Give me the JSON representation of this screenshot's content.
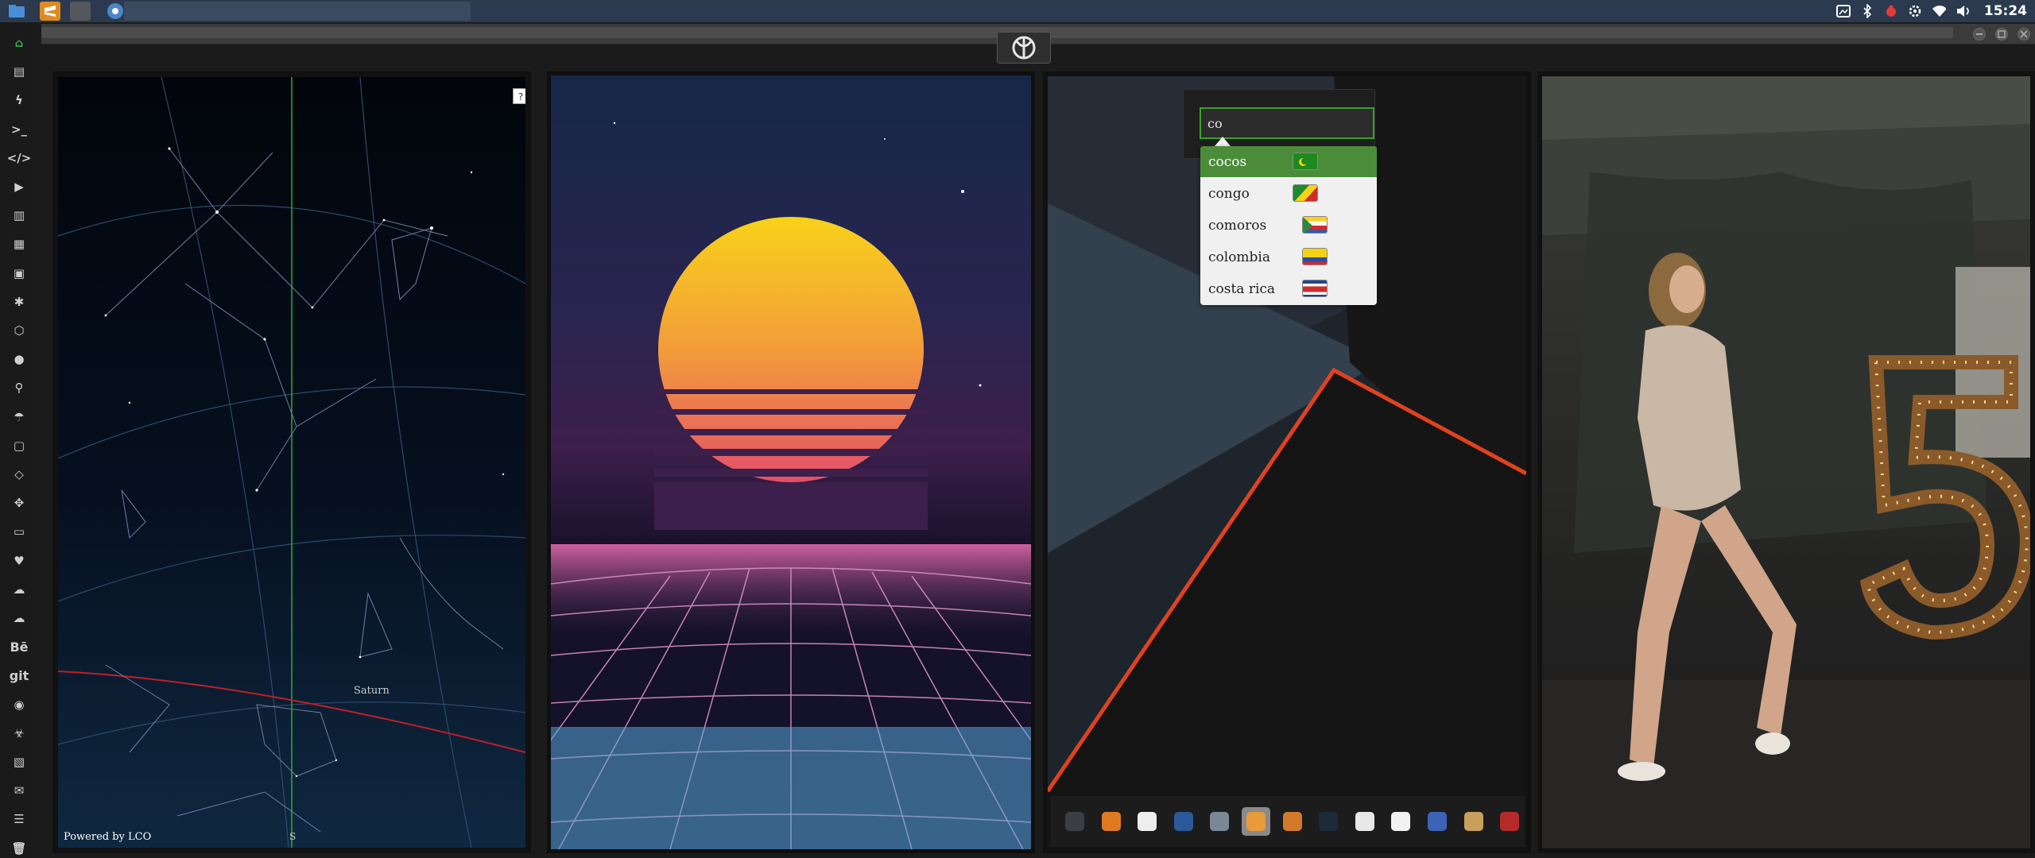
{
  "system": {
    "clock": "15:24"
  },
  "sky_panel": {
    "help_label": "?",
    "credit": "Powered by LCO",
    "planet_label": "Saturn",
    "direction_label": "S"
  },
  "search": {
    "value": "co",
    "suggestions": [
      {
        "label": "cocos",
        "flag": "flag-cocos-islands"
      },
      {
        "label": "congo",
        "flag": "flag-congo"
      },
      {
        "label": "comoros",
        "flag": "flag-comoros"
      },
      {
        "label": "colombia",
        "flag": "flag-colombia"
      },
      {
        "label": "costa rica",
        "flag": "flag-costa-rica"
      }
    ],
    "active_index": 0
  },
  "sidebar": {
    "items": [
      {
        "icon": "home-icon"
      },
      {
        "icon": "document-icon"
      },
      {
        "icon": "bolt-icon"
      },
      {
        "icon": "terminal-icon"
      },
      {
        "icon": "code-icon"
      },
      {
        "icon": "play-icon"
      },
      {
        "icon": "translate-icon"
      },
      {
        "icon": "image-icon"
      },
      {
        "icon": "news-icon"
      },
      {
        "icon": "settings-icon"
      },
      {
        "icon": "hexagon-icon"
      },
      {
        "icon": "globe-icon"
      },
      {
        "icon": "search-icon"
      },
      {
        "icon": "umbrella-icon"
      },
      {
        "icon": "contact-icon"
      },
      {
        "icon": "tag-icon"
      },
      {
        "icon": "fullscreen-icon"
      },
      {
        "icon": "youtube-icon"
      },
      {
        "icon": "heart-icon"
      },
      {
        "icon": "cloud-outline-icon"
      },
      {
        "icon": "cloud-icon"
      },
      {
        "label": "Bē",
        "icon": "behance-icon"
      },
      {
        "label": "git",
        "icon": "git-icon"
      },
      {
        "icon": "github-icon"
      },
      {
        "icon": "biohazard-icon"
      },
      {
        "icon": "map-icon"
      },
      {
        "icon": "mail-icon"
      },
      {
        "icon": "list-icon"
      },
      {
        "icon": "trash-icon"
      }
    ]
  },
  "dock": {
    "items": [
      {
        "icon": "calculator-icon"
      },
      {
        "icon": "sublime-icon"
      },
      {
        "icon": "calendar-icon"
      },
      {
        "icon": "globe-icon"
      },
      {
        "icon": "clock-icon"
      },
      {
        "icon": "search-icon"
      },
      {
        "icon": "photos-icon"
      },
      {
        "icon": "earth-icon"
      },
      {
        "icon": "flask-icon"
      },
      {
        "icon": "sheet-icon"
      },
      {
        "icon": "blue-circle-icon"
      },
      {
        "icon": "pyramid-icon"
      },
      {
        "icon": "red-a-icon"
      }
    ]
  },
  "colors": {
    "accent_green": "#4b8c3a",
    "topbar": "#2b3a4e"
  }
}
